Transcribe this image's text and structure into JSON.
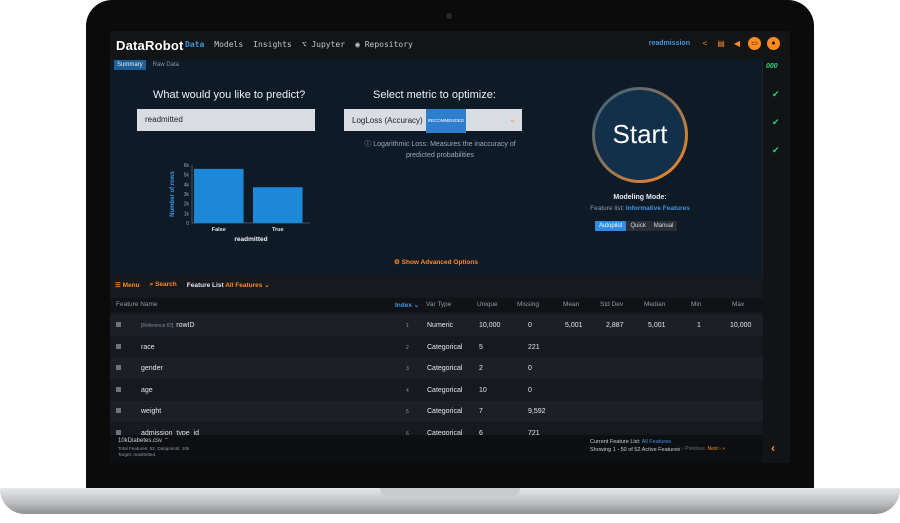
{
  "app": {
    "logo": "DataRobot",
    "project": "readmission"
  },
  "nav": [
    "Data",
    "Models",
    "Insights",
    "Jupyter",
    "Repository"
  ],
  "subtabs": [
    "Summary",
    "Raw Data"
  ],
  "predict": {
    "label": "What would you like to predict?",
    "value": "readmitted"
  },
  "metric": {
    "label": "Select metric to optimize:",
    "value": "LogLoss (Accuracy)",
    "badge": "RECOMMENDED",
    "info_line1": "Logarithmic Loss: Measures the inaccuracy of",
    "info_line2": "predicted probabilities"
  },
  "start": {
    "label": "Start",
    "modeling_mode": "Modeling Mode:",
    "feature_list_prefix": "Feature list:",
    "feature_list_value": "Informative Features",
    "modes": [
      "Autopilot",
      "Quick",
      "Manual"
    ],
    "active_mode": "Autopilot"
  },
  "advanced": "Show Advanced Options",
  "chart_data": {
    "type": "bar",
    "categories": [
      "False",
      "True"
    ],
    "values": [
      5600,
      3700
    ],
    "xlabel": "readmitted",
    "ylabel": "Number of rows",
    "yticks": [
      "0",
      "1k",
      "2k",
      "3k",
      "4k",
      "5k",
      "6k"
    ],
    "ylim": [
      0,
      6000
    ],
    "color": "#1e88d8"
  },
  "toolbar": {
    "menu": "Menu",
    "search": "Search",
    "feature_list_label": "Feature List",
    "feature_list_value": "All Features"
  },
  "table": {
    "headers": [
      "Feature Name",
      "Index",
      "Var Type",
      "Unique",
      "Missing",
      "Mean",
      "Std Dev",
      "Median",
      "Min",
      "Max"
    ],
    "rows": [
      {
        "ref": "[Reference ID]",
        "name": "rowID",
        "index": "1",
        "type": "Numeric",
        "unique": "10,000",
        "missing": "0",
        "mean": "5,001",
        "std": "2,887",
        "median": "5,001",
        "min": "1",
        "max": "10,000"
      },
      {
        "ref": "",
        "name": "race",
        "index": "2",
        "type": "Categorical",
        "unique": "5",
        "missing": "221",
        "mean": "",
        "std": "",
        "median": "",
        "min": "",
        "max": ""
      },
      {
        "ref": "",
        "name": "gender",
        "index": "3",
        "type": "Categorical",
        "unique": "2",
        "missing": "0",
        "mean": "",
        "std": "",
        "median": "",
        "min": "",
        "max": ""
      },
      {
        "ref": "",
        "name": "age",
        "index": "4",
        "type": "Categorical",
        "unique": "10",
        "missing": "0",
        "mean": "",
        "std": "",
        "median": "",
        "min": "",
        "max": ""
      },
      {
        "ref": "",
        "name": "weight",
        "index": "5",
        "type": "Categorical",
        "unique": "7",
        "missing": "9,592",
        "mean": "",
        "std": "",
        "median": "",
        "min": "",
        "max": ""
      },
      {
        "ref": "",
        "name": "admission_type_id",
        "index": "6",
        "type": "Categorical",
        "unique": "6",
        "missing": "721",
        "mean": "",
        "std": "",
        "median": "",
        "min": "",
        "max": ""
      }
    ]
  },
  "footer": {
    "file": "10kDiabetes.csv",
    "meta1": "Total Features: 52, Datapoints: 10k",
    "meta2": "Target: readmitted",
    "current_label": "Current Feature List:",
    "current_value": "All Features",
    "showing": "Showing 1 - 50 of 52 Active Features",
    "prev": "Previous",
    "next": "Next"
  },
  "rail": {
    "score": "000"
  }
}
